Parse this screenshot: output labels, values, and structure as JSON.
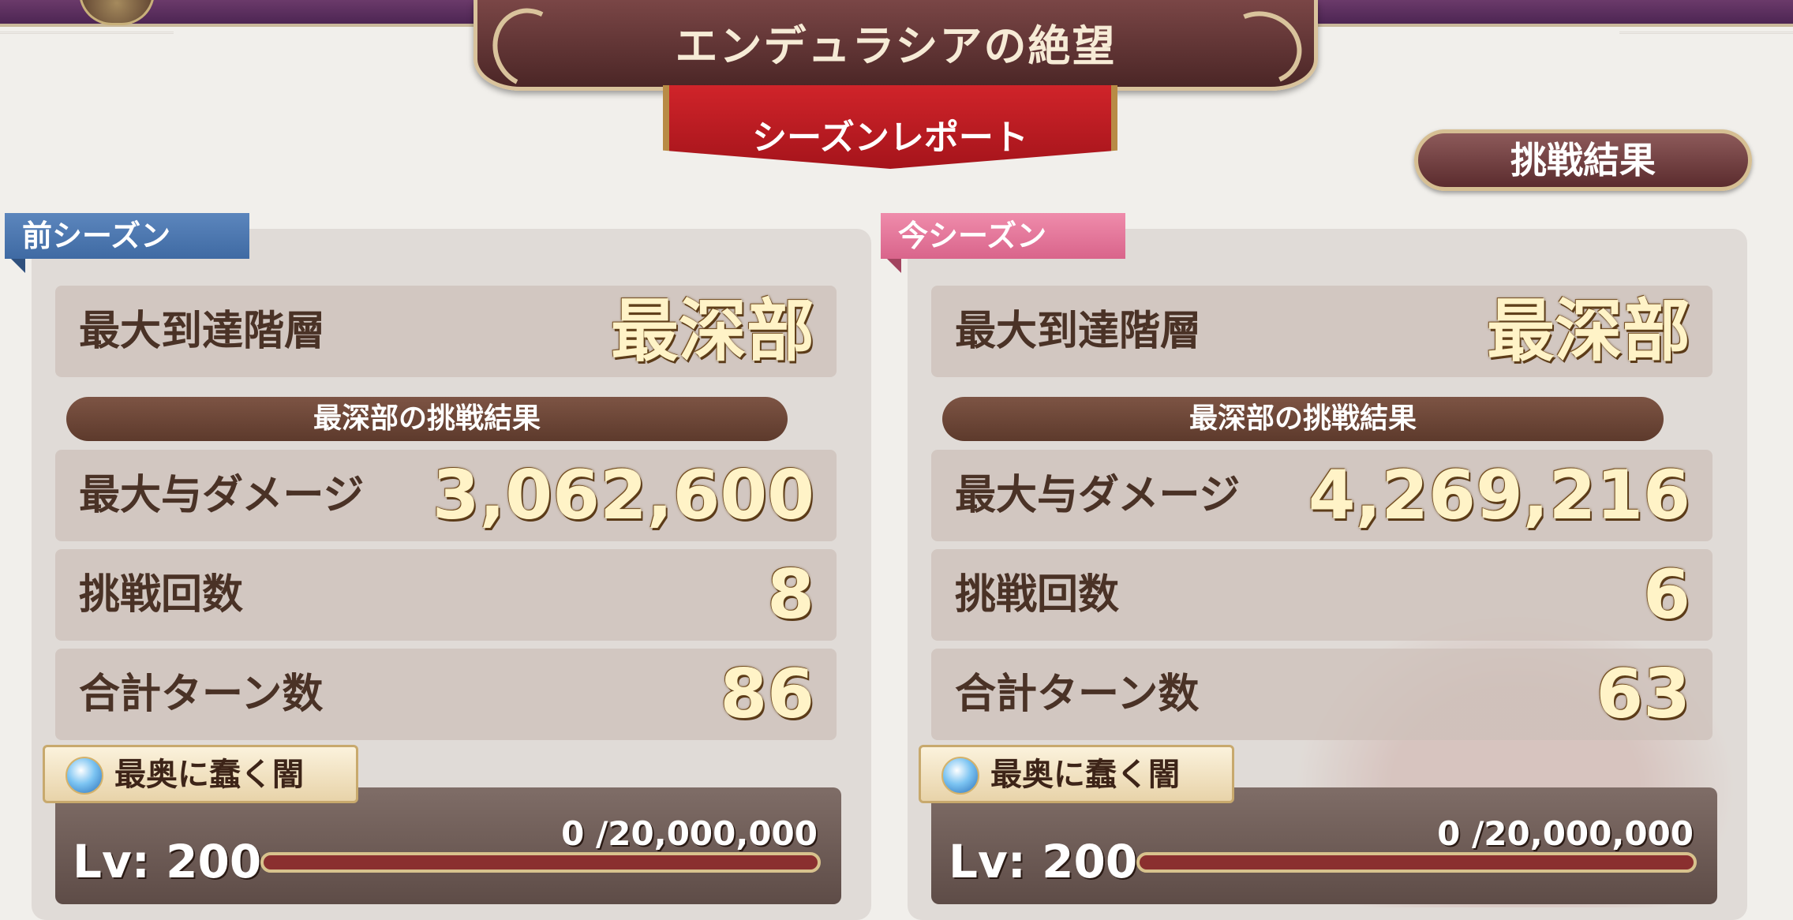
{
  "header": {
    "title": "エンデュラシアの絶望",
    "subtitle": "シーズンレポート",
    "result_button": "挑戦結果"
  },
  "prev_season": {
    "tag": "前シーズン",
    "max_floor_label": "最大到達階層",
    "max_floor_value": "最深部",
    "section_label": "最深部の挑戦結果",
    "max_damage_label": "最大与ダメージ",
    "max_damage_value": "3,062,600",
    "attempts_label": "挑戦回数",
    "attempts_value": "8",
    "turns_label": "合計ターン数",
    "turns_value": "86",
    "boss": {
      "name": "最奥に蠢く闇",
      "level": "Lv: 200",
      "hp": "0 /20,000,000",
      "icon": "crystal-orb-icon"
    }
  },
  "cur_season": {
    "tag": "今シーズン",
    "max_floor_label": "最大到達階層",
    "max_floor_value": "最深部",
    "section_label": "最深部の挑戦結果",
    "max_damage_label": "最大与ダメージ",
    "max_damage_value": "4,269,216",
    "attempts_label": "挑戦回数",
    "attempts_value": "6",
    "turns_label": "合計ターン数",
    "turns_value": "63",
    "boss": {
      "name": "最奥に蠢く闇",
      "level": "Lv: 200",
      "hp": "0 /20,000,000",
      "icon": "crystal-orb-icon"
    }
  },
  "colors": {
    "prev_tag": "#4a76b0",
    "cur_tag": "#e57a9d",
    "ribbon": "#c21d24",
    "value_gold": "#fff3c7"
  }
}
